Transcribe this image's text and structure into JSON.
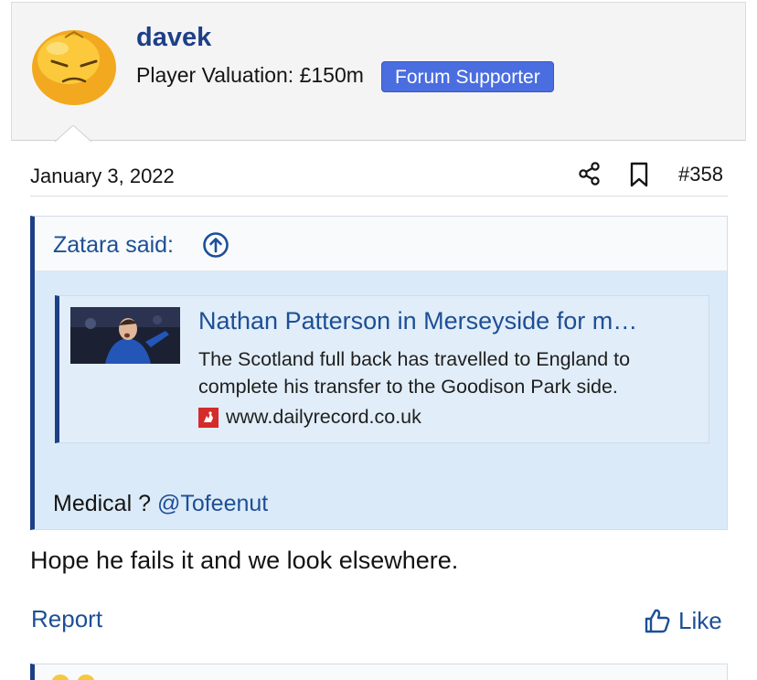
{
  "user": {
    "name": "davek",
    "valuation": "Player Valuation: £150m",
    "badge": "Forum Supporter"
  },
  "meta": {
    "date": "January 3, 2022",
    "post_number": "#358"
  },
  "quote": {
    "author": "Zatara said:",
    "embed": {
      "title": "Nathan Patterson in Merseyside for m…",
      "description": "The Scotland full back has travelled to England to complete his transfer to the Goodison Park side.",
      "domain": "www.dailyrecord.co.uk"
    },
    "body_text": "Medical ? ",
    "mention": "@Tofeenut"
  },
  "post": {
    "text": "Hope he fails it and we look elsewhere."
  },
  "actions": {
    "report": "Report",
    "like": "Like"
  },
  "colors": {
    "link": "#1d4f96",
    "username": "#1d3f86",
    "badge_bg": "#4a6de0",
    "quote_bg": "#dbeaf8"
  },
  "icons": [
    "share-icon",
    "bookmark-icon",
    "arrow-up-circle-icon",
    "thumbs-up-icon",
    "favicon-icon"
  ]
}
